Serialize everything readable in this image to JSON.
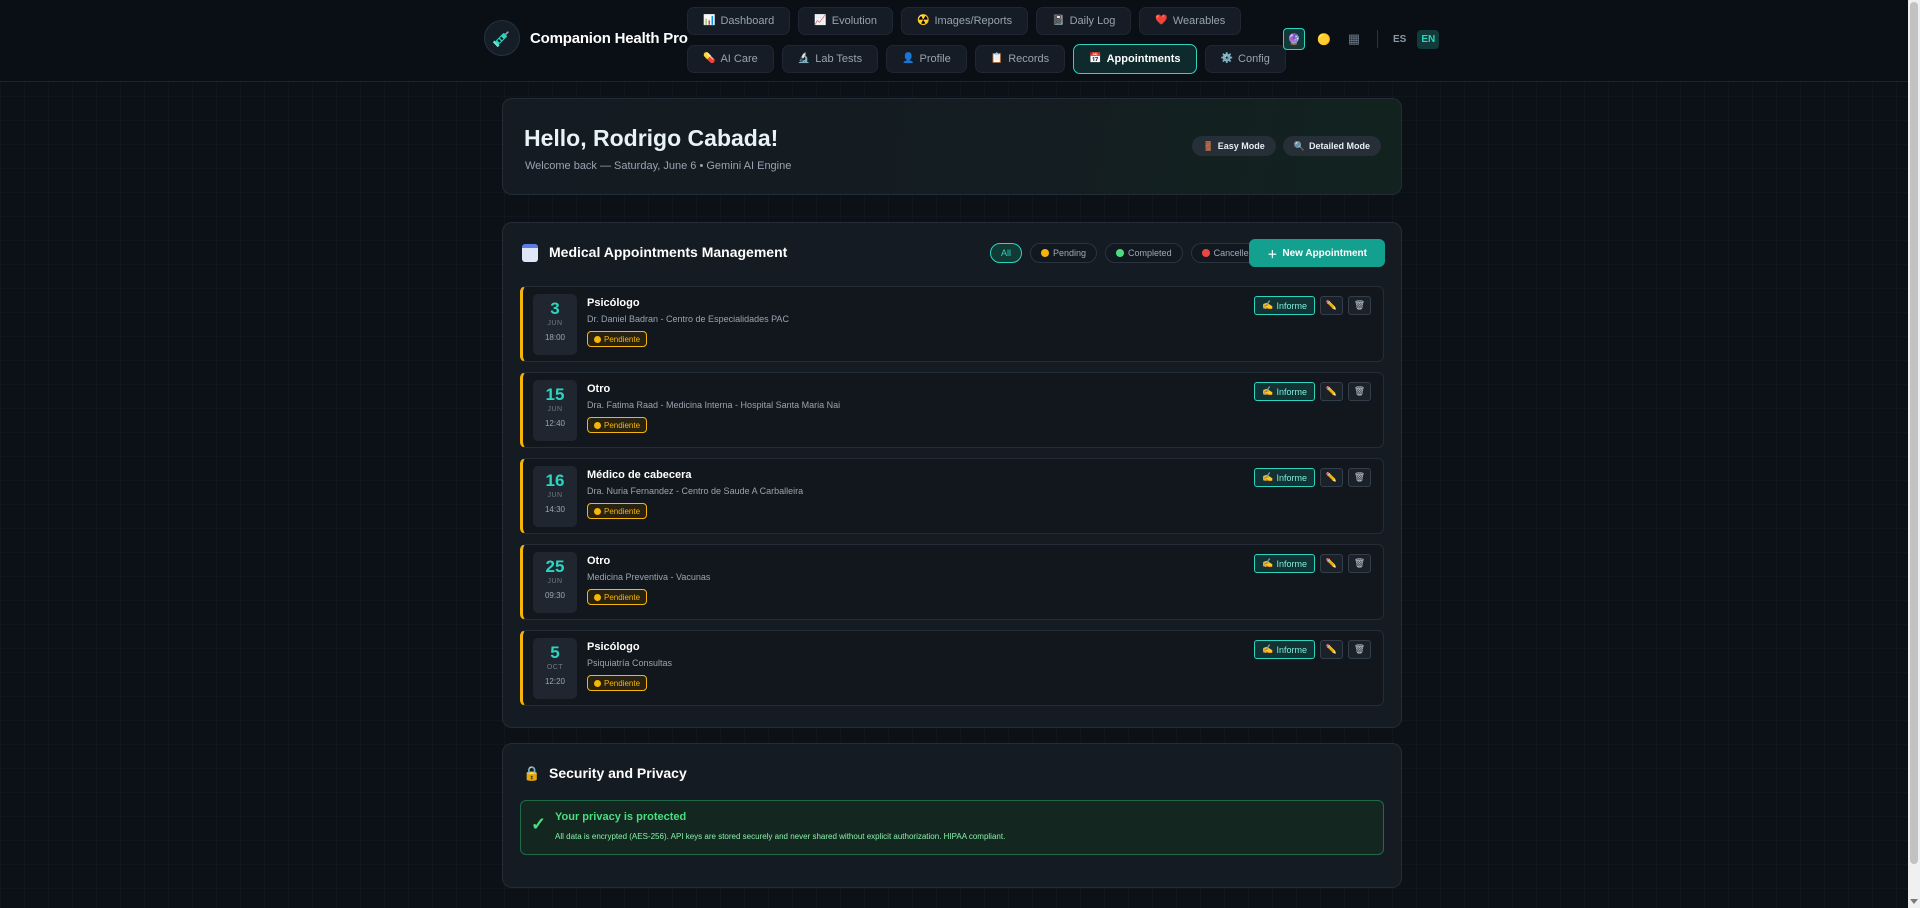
{
  "app": {
    "name": "Companion Health Pro",
    "logo_icon": "syringe-icon"
  },
  "nav": {
    "row1": [
      {
        "label": "Dashboard",
        "icon": "📊"
      },
      {
        "label": "Evolution",
        "icon": "📈"
      },
      {
        "label": "Images/Reports",
        "icon": "☢️"
      },
      {
        "label": "Daily Log",
        "icon": "📓"
      },
      {
        "label": "Wearables",
        "icon": "❤️"
      }
    ],
    "row2": [
      {
        "label": "AI Care",
        "icon": "💊"
      },
      {
        "label": "Lab Tests",
        "icon": "🔬"
      },
      {
        "label": "Profile",
        "icon": "👤"
      },
      {
        "label": "Records",
        "icon": "📋"
      },
      {
        "label": "Appointments",
        "icon": "📅",
        "active": true
      },
      {
        "label": "Config",
        "icon": "⚙️"
      }
    ]
  },
  "tools": {
    "theme_dark_icon": "🔮",
    "theme_light_icon": "🟡",
    "grid_icon": "▦",
    "lang_es": "ES",
    "lang_en": "EN",
    "active_lang": "EN"
  },
  "greeting": {
    "title": "Hello, Rodrigo Cabada!",
    "subtitle": "Welcome back — Saturday, June 6 • Gemini AI Engine",
    "easy_mode": {
      "icon": "🚪",
      "label": "Easy Mode"
    },
    "detailed_mode": {
      "icon": "🔍",
      "label": "Detailed Mode"
    }
  },
  "appointments": {
    "title": "Medical Appointments Management",
    "filters": [
      {
        "label": "All",
        "active": true,
        "dot": null
      },
      {
        "label": "Pending",
        "dot": "#f5b50a"
      },
      {
        "label": "Completed",
        "dot": "#4ade80"
      },
      {
        "label": "Cancelled",
        "dot": "#ef4444"
      }
    ],
    "new_button": {
      "icon": "＋",
      "label": "New Appointment"
    },
    "items": [
      {
        "day": "3",
        "month": "JUN",
        "time": "18:00",
        "title": "Psicólogo",
        "detail": "Dr. Daniel Badran - Centro de Especialidades PAC",
        "status": "Pendiente"
      },
      {
        "day": "15",
        "month": "JUN",
        "time": "12:40",
        "title": "Otro",
        "detail": "Dra. Fatima Raad - Medicina Interna - Hospital Santa Maria Nai",
        "status": "Pendiente"
      },
      {
        "day": "16",
        "month": "JUN",
        "time": "14:30",
        "title": "Médico de cabecera",
        "detail": "Dra. Nuria Fernandez - Centro de Saude A Carballeira",
        "status": "Pendiente"
      },
      {
        "day": "25",
        "month": "JUN",
        "time": "09:30",
        "title": "Otro",
        "detail": "Medicina Preventiva - Vacunas",
        "status": "Pendiente"
      },
      {
        "day": "5",
        "month": "OCT",
        "time": "12:20",
        "title": "Psicólogo",
        "detail": "Psiquiatría Consultas",
        "status": "Pendiente"
      }
    ],
    "actions": {
      "report_icon": "✍️",
      "report_label": "Informe",
      "edit_icon": "✏️",
      "delete_icon": "🗑"
    }
  },
  "security": {
    "title": "Security and Privacy",
    "icon": "🔒",
    "check_icon": "✓",
    "heading": "Your privacy is protected",
    "text": "All data is encrypted (AES-256). API keys are stored securely and never shared without explicit authorization. HIPAA compliant."
  },
  "colors": {
    "accent": "#2dd4bf",
    "pending": "#f5b50a",
    "success": "#4ade80",
    "danger": "#ef4444",
    "background": "#0c1117"
  }
}
